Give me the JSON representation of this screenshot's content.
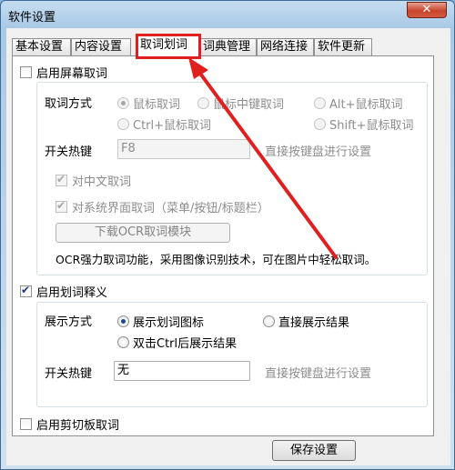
{
  "window": {
    "title": "软件设置",
    "close_label": "✕"
  },
  "tabs": [
    "基本设置",
    "内容设置",
    "取词划词",
    "词典管理",
    "网络连接",
    "软件更新"
  ],
  "screen_capture": {
    "enable_label": "启用屏幕取词",
    "mode_label": "取词方式",
    "modes": [
      "鼠标取词",
      "鼠标中键取词",
      "Alt+鼠标取词",
      "Ctrl+鼠标取词",
      "Shift+鼠标取词"
    ],
    "hotkey_label": "开关热键",
    "hotkey_value": "F8",
    "hotkey_hint": "直接按键盘进行设置",
    "chinese_label": "对中文取词",
    "sysui_label": "对系统界面取词（菜单/按钮/标题栏）",
    "ocr_button": "下载OCR取词模块",
    "ocr_desc": "OCR强力取词功能，采用图像识别技术，可在图片中轻松取词。"
  },
  "selection": {
    "enable_label": "启用划词释义",
    "display_label": "展示方式",
    "options": [
      "展示划词图标",
      "直接展示结果",
      "双击Ctrl后展示结果"
    ],
    "hotkey_label": "开关热键",
    "hotkey_value": "无",
    "hotkey_hint": "直接按键盘进行设置"
  },
  "clipboard": {
    "enable_label": "启用剪切板取词"
  },
  "footer": {
    "save_label": "保存设置"
  },
  "colors": {
    "highlight": "#e0201e",
    "arrow": "#e0201e"
  }
}
